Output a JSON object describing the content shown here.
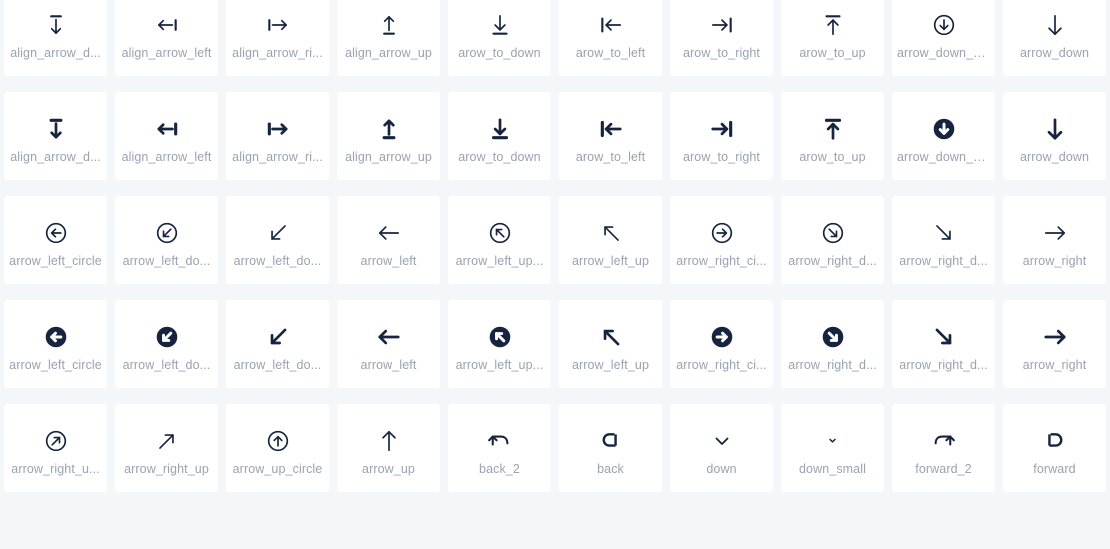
{
  "theme": {
    "page_background": "#f4f7fa",
    "card_background": "#ffffff",
    "icon_color": "#16243f",
    "label_color": "#9aa3b0"
  },
  "grid": {
    "columns": 10,
    "rows": 5
  },
  "icons": [
    {
      "label": "align_arrow_d...",
      "icon": "align-arrow-down-icon",
      "weight": "regular"
    },
    {
      "label": "align_arrow_left",
      "icon": "align-arrow-left-icon",
      "weight": "regular"
    },
    {
      "label": "align_arrow_ri...",
      "icon": "align-arrow-right-icon",
      "weight": "regular"
    },
    {
      "label": "align_arrow_up",
      "icon": "align-arrow-up-icon",
      "weight": "regular"
    },
    {
      "label": "arow_to_down",
      "icon": "arrow-to-down-icon",
      "weight": "regular"
    },
    {
      "label": "arow_to_left",
      "icon": "arrow-to-left-icon",
      "weight": "regular"
    },
    {
      "label": "arow_to_right",
      "icon": "arrow-to-right-icon",
      "weight": "regular"
    },
    {
      "label": "arow_to_up",
      "icon": "arrow-to-up-icon",
      "weight": "regular"
    },
    {
      "label": "arrow_down_c...",
      "icon": "arrow-down-circle-icon",
      "weight": "regular"
    },
    {
      "label": "arrow_down",
      "icon": "arrow-down-icon",
      "weight": "regular"
    },
    {
      "label": "align_arrow_d...",
      "icon": "align-arrow-down-icon",
      "weight": "bold"
    },
    {
      "label": "align_arrow_left",
      "icon": "align-arrow-left-icon",
      "weight": "bold"
    },
    {
      "label": "align_arrow_ri...",
      "icon": "align-arrow-right-icon",
      "weight": "bold"
    },
    {
      "label": "align_arrow_up",
      "icon": "align-arrow-up-icon",
      "weight": "bold"
    },
    {
      "label": "arow_to_down",
      "icon": "arrow-to-down-icon",
      "weight": "bold"
    },
    {
      "label": "arow_to_left",
      "icon": "arrow-to-left-icon",
      "weight": "bold"
    },
    {
      "label": "arow_to_right",
      "icon": "arrow-to-right-icon",
      "weight": "bold"
    },
    {
      "label": "arow_to_up",
      "icon": "arrow-to-up-icon",
      "weight": "bold"
    },
    {
      "label": "arrow_down_c...",
      "icon": "arrow-down-circle-icon",
      "weight": "bold"
    },
    {
      "label": "arrow_down",
      "icon": "arrow-down-icon",
      "weight": "bold"
    },
    {
      "label": "arrow_left_circle",
      "icon": "arrow-left-circle-icon",
      "weight": "regular"
    },
    {
      "label": "arrow_left_do...",
      "icon": "arrow-left-down-circle-icon",
      "weight": "regular"
    },
    {
      "label": "arrow_left_do...",
      "icon": "arrow-left-down-icon",
      "weight": "regular"
    },
    {
      "label": "arrow_left",
      "icon": "arrow-left-icon",
      "weight": "regular"
    },
    {
      "label": "arrow_left_up...",
      "icon": "arrow-left-up-circle-icon",
      "weight": "regular"
    },
    {
      "label": "arrow_left_up",
      "icon": "arrow-left-up-icon",
      "weight": "regular"
    },
    {
      "label": "arrow_right_ci...",
      "icon": "arrow-right-circle-icon",
      "weight": "regular"
    },
    {
      "label": "arrow_right_d...",
      "icon": "arrow-right-down-circle-icon",
      "weight": "regular"
    },
    {
      "label": "arrow_right_d...",
      "icon": "arrow-right-down-icon",
      "weight": "regular"
    },
    {
      "label": "arrow_right",
      "icon": "arrow-right-icon",
      "weight": "regular"
    },
    {
      "label": "arrow_left_circle",
      "icon": "arrow-left-circle-icon",
      "weight": "bold"
    },
    {
      "label": "arrow_left_do...",
      "icon": "arrow-left-down-circle-icon",
      "weight": "bold"
    },
    {
      "label": "arrow_left_do...",
      "icon": "arrow-left-down-icon",
      "weight": "bold"
    },
    {
      "label": "arrow_left",
      "icon": "arrow-left-icon",
      "weight": "bold"
    },
    {
      "label": "arrow_left_up...",
      "icon": "arrow-left-up-circle-icon",
      "weight": "bold"
    },
    {
      "label": "arrow_left_up",
      "icon": "arrow-left-up-icon",
      "weight": "bold"
    },
    {
      "label": "arrow_right_ci...",
      "icon": "arrow-right-circle-icon",
      "weight": "bold"
    },
    {
      "label": "arrow_right_d...",
      "icon": "arrow-right-down-circle-icon",
      "weight": "bold"
    },
    {
      "label": "arrow_right_d...",
      "icon": "arrow-right-down-icon",
      "weight": "bold"
    },
    {
      "label": "arrow_right",
      "icon": "arrow-right-icon",
      "weight": "bold"
    },
    {
      "label": "arrow_right_u...",
      "icon": "arrow-right-up-circle-icon",
      "weight": "regular"
    },
    {
      "label": "arrow_right_up",
      "icon": "arrow-right-up-icon",
      "weight": "regular"
    },
    {
      "label": "arrow_up_circle",
      "icon": "arrow-up-circle-icon",
      "weight": "regular"
    },
    {
      "label": "arrow_up",
      "icon": "arrow-up-icon",
      "weight": "regular"
    },
    {
      "label": "back_2",
      "icon": "back-2-icon",
      "weight": "regular"
    },
    {
      "label": "back",
      "icon": "back-icon",
      "weight": "regular"
    },
    {
      "label": "down",
      "icon": "chevron-down-icon",
      "weight": "regular"
    },
    {
      "label": "down_small",
      "icon": "chevron-down-small-icon",
      "weight": "regular"
    },
    {
      "label": "forward_2",
      "icon": "forward-2-icon",
      "weight": "regular"
    },
    {
      "label": "forward",
      "icon": "forward-icon",
      "weight": "regular"
    }
  ]
}
